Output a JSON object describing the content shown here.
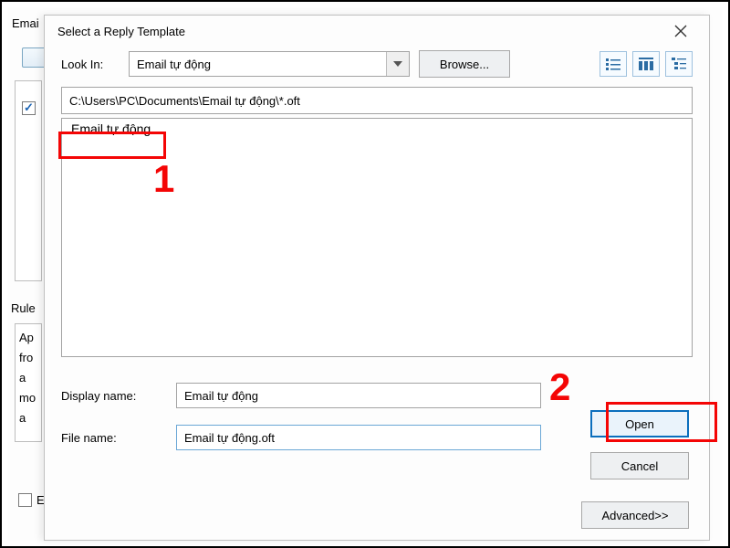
{
  "background": {
    "heading_left": "Emai",
    "rules_label": "Rule",
    "rule_lines": [
      "Ap",
      "fro",
      " a",
      "mo",
      " a"
    ],
    "bottom_checkbox_label": "E"
  },
  "dialog": {
    "title": "Select a Reply Template",
    "lookin_label": "Look In:",
    "lookin_value": "Email tự động",
    "browse_label": "Browse...",
    "path": "C:\\Users\\PC\\Documents\\Email tự động\\*.oft",
    "file_item": "Email tự động",
    "display_name_label": "Display name:",
    "display_name_value": "Email tự động",
    "file_name_label": "File name:",
    "file_name_value": "Email tự động.oft",
    "open_label": "Open",
    "cancel_label": "Cancel",
    "advanced_label": "Advanced>>"
  },
  "annotations": {
    "num1": "1",
    "num2": "2"
  }
}
